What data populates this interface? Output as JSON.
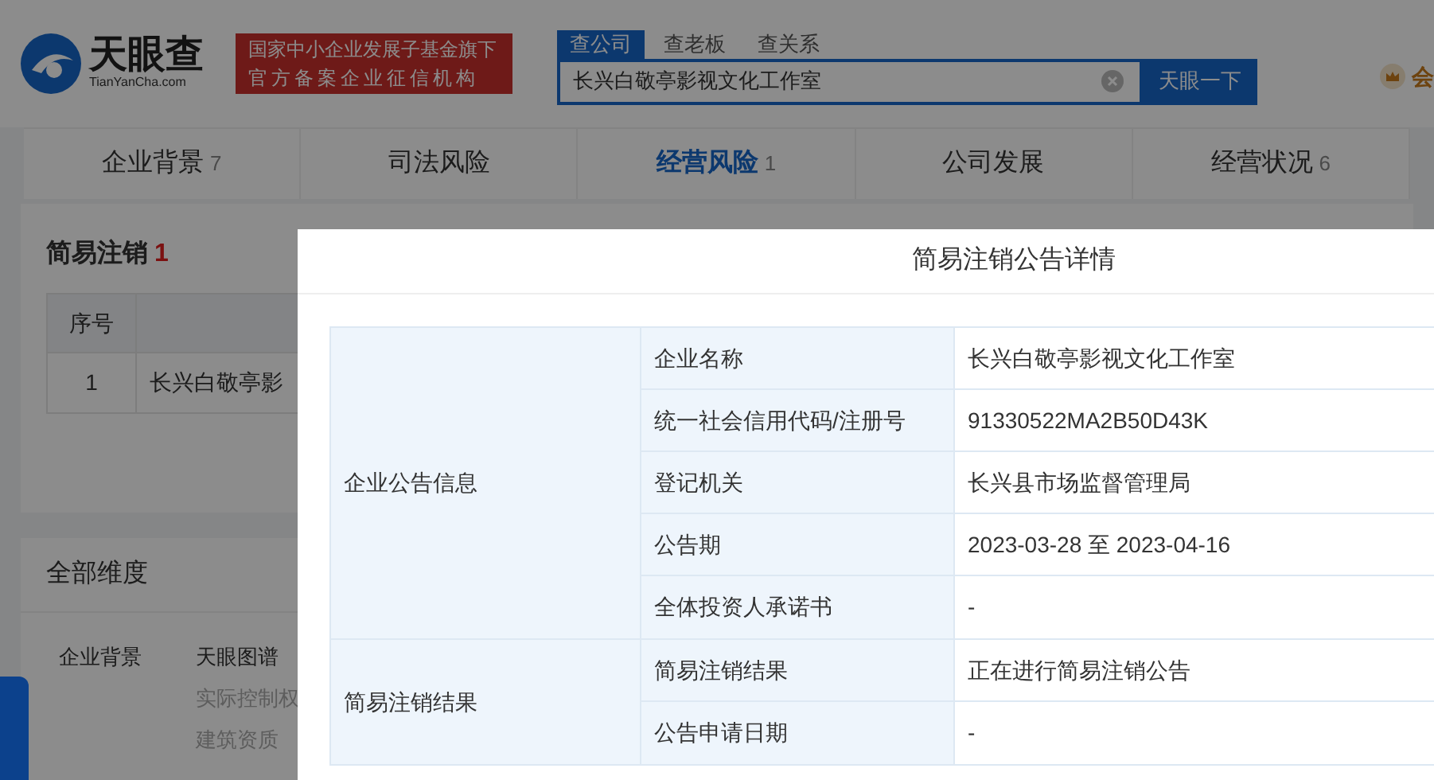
{
  "header": {
    "logo": {
      "name": "天眼查",
      "domain": "TianYanCha.com"
    },
    "slogan": [
      "国家中小企业发展子基金旗下",
      "官方备案企业征信机构"
    ],
    "search_tabs": [
      {
        "label": "查公司",
        "selected": true
      },
      {
        "label": "查老板",
        "selected": false
      },
      {
        "label": "查关系",
        "selected": false
      }
    ],
    "search": {
      "value": "长兴白敬亭影视文化工作室"
    },
    "search_button": "天眼一下",
    "member_link": "会"
  },
  "nav_tabs": [
    {
      "label": "企业背景",
      "count": "7",
      "selected": false
    },
    {
      "label": "司法风险",
      "selected": false
    },
    {
      "label": "经营风险",
      "count": "1",
      "selected": true
    },
    {
      "label": "公司发展",
      "selected": false
    },
    {
      "label": "经营状况",
      "count": "6",
      "selected": false
    }
  ],
  "section": {
    "title": "简易注销",
    "count": "1",
    "table": {
      "columns": [
        "序号"
      ],
      "rows": [
        [
          "1",
          "长兴白敬亭影"
        ]
      ]
    }
  },
  "dimensions": {
    "title": "全部维度",
    "groups": [
      {
        "label": "企业背景",
        "items": [
          {
            "label": "天眼图谱",
            "disabled": false
          },
          {
            "label": "实际控制权",
            "disabled": true
          },
          {
            "label": "建筑资质",
            "disabled": true
          }
        ]
      }
    ]
  },
  "modal": {
    "title": "简易注销公告详情",
    "groups": [
      {
        "label": "企业公告信息",
        "rows": [
          {
            "label": "企业名称",
            "value": "长兴白敬亭影视文化工作室"
          },
          {
            "label": "统一社会信用代码/注册号",
            "value": "91330522MA2B50D43K"
          },
          {
            "label": "登记机关",
            "value": "长兴县市场监督管理局"
          },
          {
            "label": "公告期",
            "value": "2023-03-28 至 2023-04-16"
          },
          {
            "label": "全体投资人承诺书",
            "value": "-"
          }
        ]
      },
      {
        "label": "简易注销结果",
        "rows": [
          {
            "label": "简易注销结果",
            "value": "正在进行简易注销公告"
          },
          {
            "label": "公告申请日期",
            "value": "-"
          }
        ]
      }
    ]
  }
}
